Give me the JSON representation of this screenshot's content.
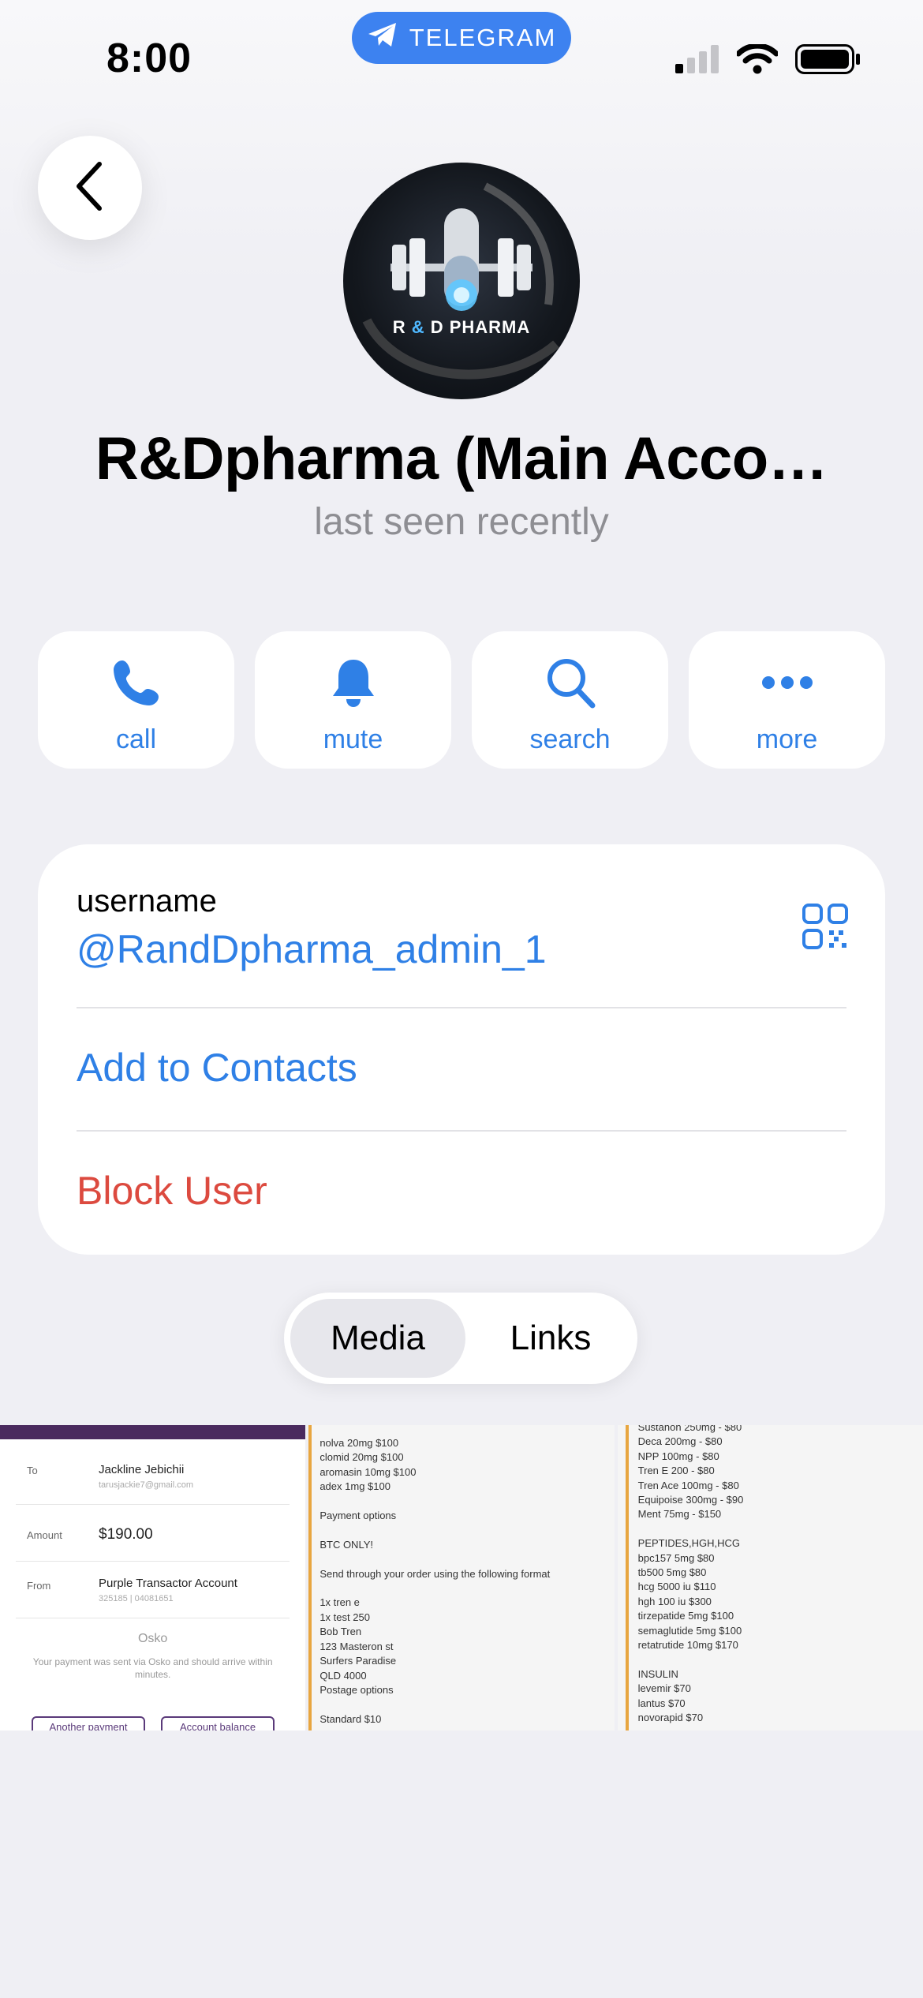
{
  "status_bar": {
    "time": "8:00",
    "app_pill": "TELEGRAM"
  },
  "profile": {
    "avatar_text": {
      "part1": "R ",
      "amp": "&",
      "part2": " D PHARMA"
    },
    "name": "R&Dpharma (Main Acco…",
    "status": "last seen recently"
  },
  "actions": [
    {
      "label": "call",
      "icon": "phone-icon"
    },
    {
      "label": "mute",
      "icon": "bell-icon"
    },
    {
      "label": "search",
      "icon": "search-icon"
    },
    {
      "label": "more",
      "icon": "more-icon"
    }
  ],
  "info": {
    "username_label": "username",
    "username_value": "@RandDpharma_admin_1",
    "add_contacts": "Add to Contacts",
    "block_user": "Block User"
  },
  "tabs": {
    "media": "Media",
    "links": "Links",
    "selected": "Media"
  },
  "media": {
    "receipt": {
      "to_label": "To",
      "to_value": "Jackline Jebichii",
      "to_sub": "tarusjackie7@gmail.com",
      "amount_label": "Amount",
      "amount_value": "$190.00",
      "from_label": "From",
      "from_value": "Purple Transactor Account",
      "from_sub": "325185 | 04081651",
      "osko": "Osko",
      "note": "Your payment was sent via Osko and should arrive within minutes.",
      "btn1": "Another payment",
      "btn2": "Account balance"
    },
    "list1": "nolva 20mg $100\nclomid 20mg $100\naromasin 10mg $100\nadex 1mg $100\n\nPayment options\n\nBTC ONLY!\n\nSend through your order using the following format\n\n1x tren e\n1x test 250\nBob Tren\n123 Masteron st\nSurfers Paradise\nQLD 4000\nPostage options\n\nStandard $10",
    "list2": "Sustanon 250mg - $80\nDeca 200mg - $80\nNPP 100mg - $80\nTren E 200 - $80\nTren Ace 100mg - $80\nEquipoise 300mg - $90\nMent 75mg - $150\n\nPEPTIDES,HGH,HCG\nbpc157 5mg $80\ntb500 5mg $80\nhcg 5000 iu $110\nhgh 100 iu $300\ntirzepatide 5mg $100\nsemaglutide 5mg $100\nretatrutide 10mg $170\n\nINSULIN\nlevemir $70\nlantus $70\nnovorapid $70"
  },
  "colors": {
    "accent": "#2f80e6",
    "destructive": "#dc4a3f",
    "telegram": "#3d82f0",
    "background": "#efeff4"
  }
}
